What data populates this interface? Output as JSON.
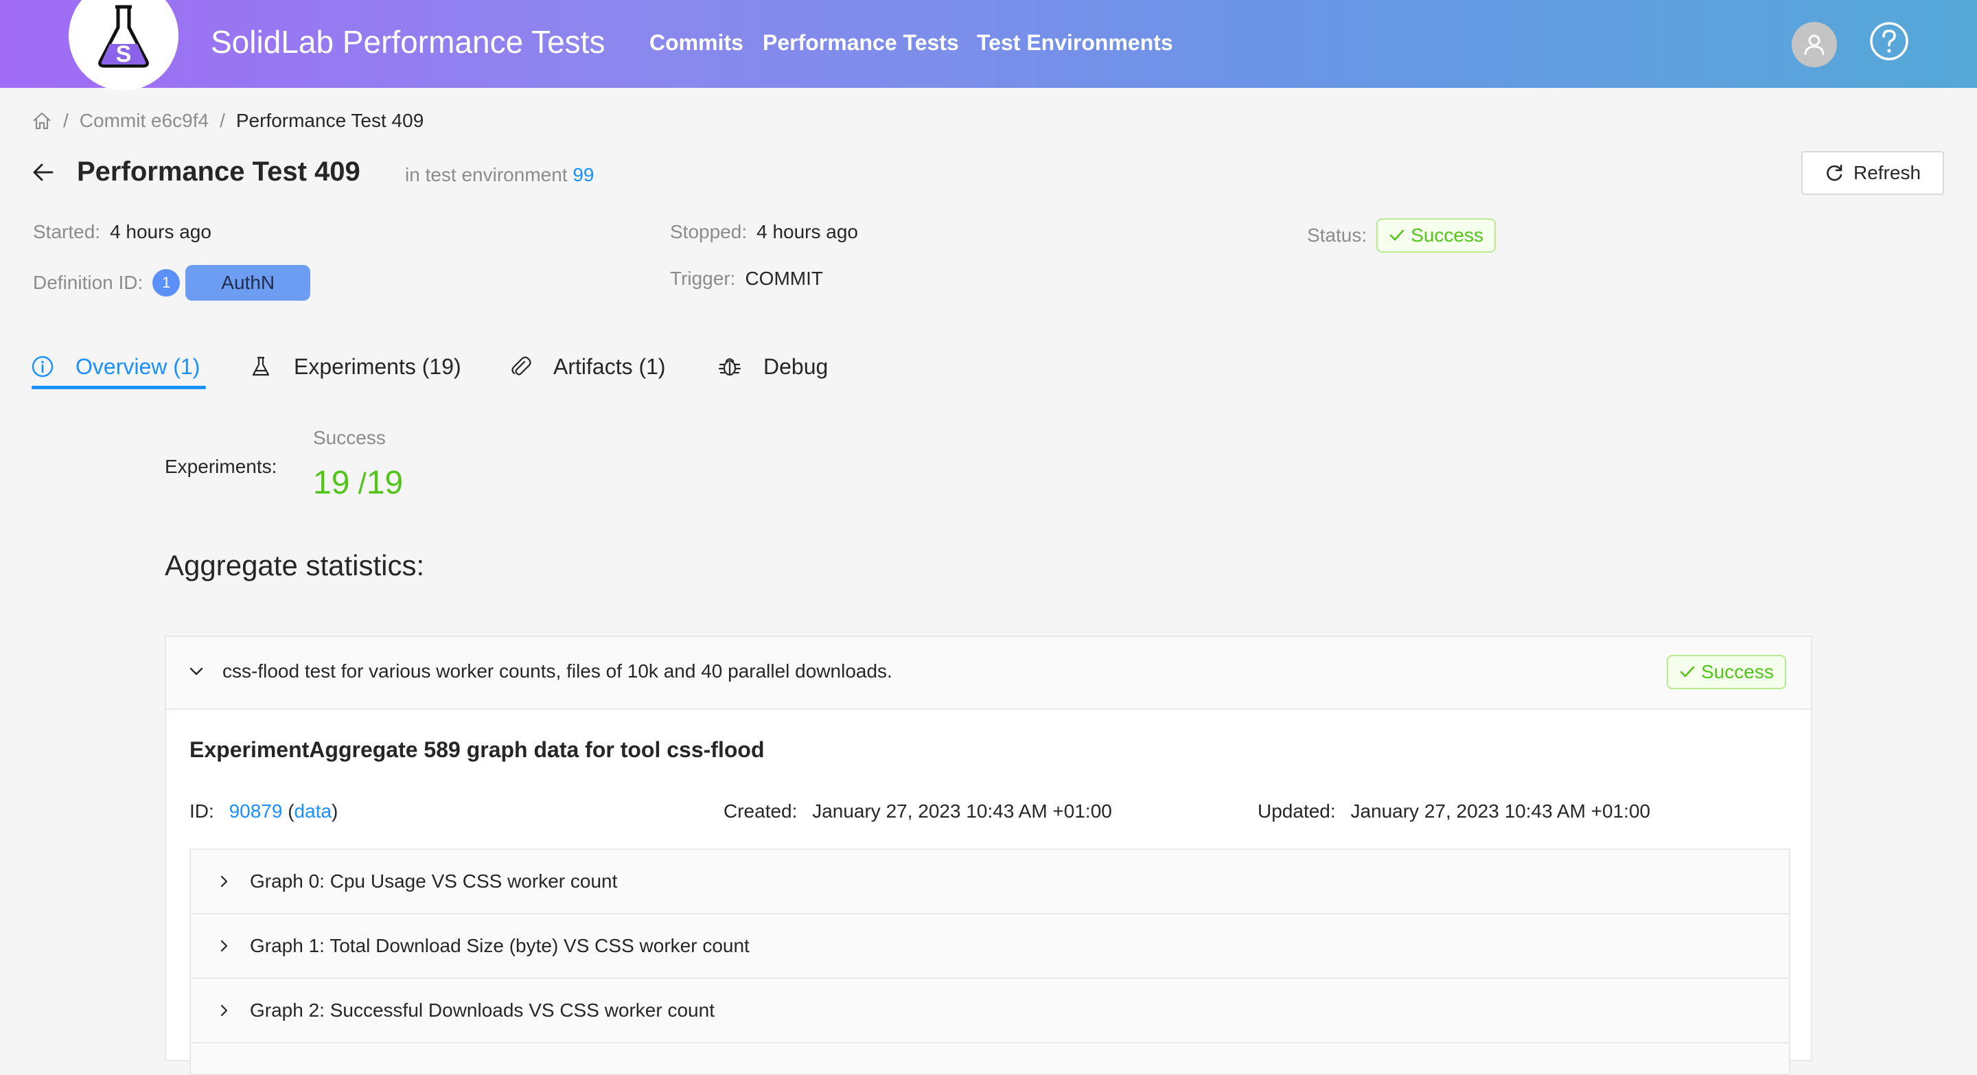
{
  "header": {
    "app_title": "SolidLab Performance Tests",
    "nav": [
      "Commits",
      "Performance Tests",
      "Test Environments"
    ],
    "logo_icon": "flask-logo-icon",
    "gradient": [
      "#a06bf5",
      "#55a8d8"
    ]
  },
  "breadcrumb": {
    "home_icon": "home-icon",
    "items": [
      "Commit e6c9f4",
      "Performance Test 409"
    ]
  },
  "page": {
    "title": "Performance Test 409",
    "env_prefix": "in test environment",
    "env_id": "99",
    "refresh_label": "Refresh"
  },
  "details": {
    "started_label": "Started",
    "started_value": "4 hours ago",
    "stopped_label": "Stopped",
    "stopped_value": "4 hours ago",
    "status_label": "Status",
    "status_value": "Success",
    "definition_label": "Definition ID",
    "definition_badge": "1",
    "definition_tag": "AuthN",
    "trigger_label": "Trigger",
    "trigger_value": "COMMIT"
  },
  "tabs": [
    {
      "label": "Overview (1)",
      "icon": "info-icon",
      "active": true
    },
    {
      "label": "Experiments (19)",
      "icon": "flask-icon",
      "active": false
    },
    {
      "label": "Artifacts (1)",
      "icon": "paperclip-icon",
      "active": false
    },
    {
      "label": "Debug",
      "icon": "bug-icon",
      "active": false
    }
  ],
  "overview": {
    "experiments_label": "Experiments:",
    "success_title": "Success",
    "success_value": "19",
    "success_total": "19",
    "aggregate_title": "Aggregate statistics:"
  },
  "panel": {
    "header_text": "css-flood test for various worker counts, files of 10k and 40 parallel downloads.",
    "status": "Success",
    "agg_title": "ExperimentAggregate 589 graph data for tool css-flood",
    "id_label": "ID",
    "id_value": "90879",
    "data_link": "data",
    "created_label": "Created",
    "created_value": "January 27, 2023 10:43 AM +01:00",
    "updated_label": "Updated",
    "updated_value": "January 27, 2023 10:43 AM +01:00",
    "graphs": [
      "Graph 0: Cpu Usage VS CSS worker count",
      "Graph 1: Total Download Size (byte) VS CSS worker count",
      "Graph 2: Successful Downloads VS CSS worker count"
    ]
  },
  "colors": {
    "accent": "#1890ff",
    "success": "#52c41a"
  }
}
